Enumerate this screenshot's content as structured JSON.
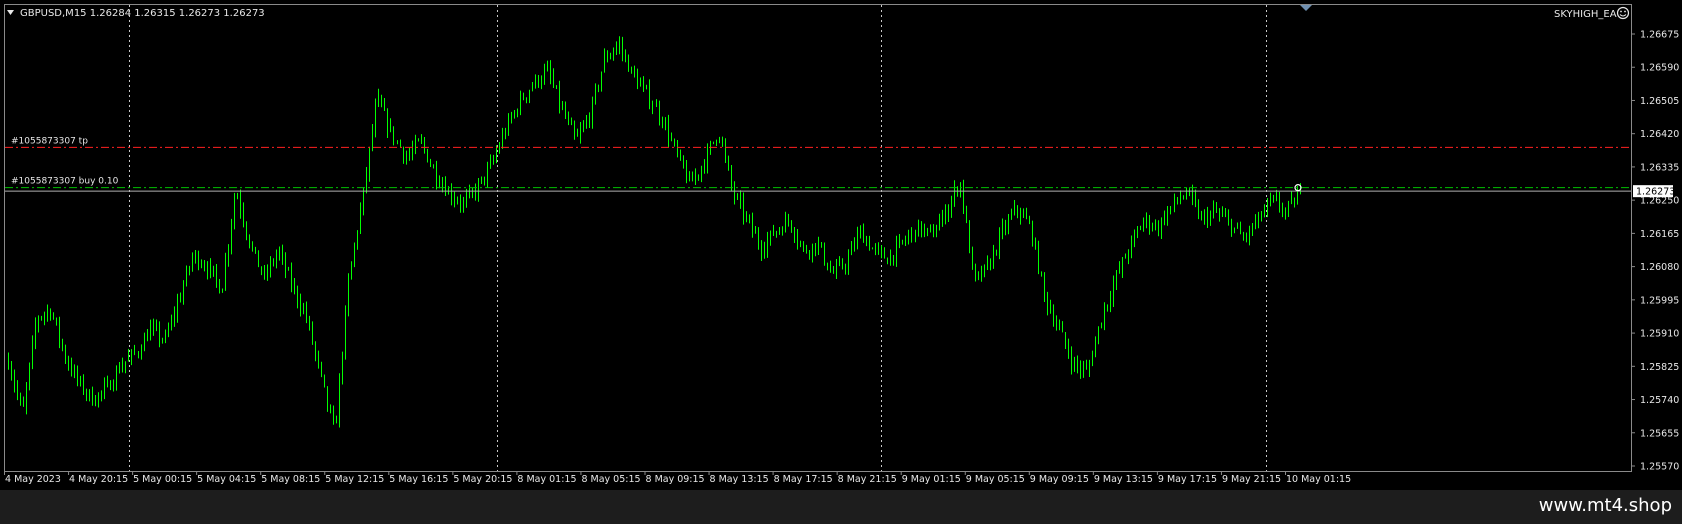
{
  "chart_header": {
    "symbol_line": "GBPUSD,M15  1.26284 1.26315 1.26273 1.26273",
    "ea_name": "SKYHIGH_EA",
    "ea_icon": "smiley-icon"
  },
  "colors": {
    "background": "#000000",
    "candles": "#00ff00",
    "grid": "#c8c8c8",
    "axis_text": "#e8e8e8",
    "tp_line": "#ff2020",
    "entry_line": "#00c000",
    "bid_line": "#b0b0b0",
    "price_label_bg": "#ffffff",
    "price_label_text": "#000000"
  },
  "trade_lines": {
    "tp_label": "#1055873307 tp",
    "tp_price": 1.26385,
    "entry_label": "#1055873307 buy 0.10",
    "entry_price": 1.26282
  },
  "current_price": "1.26273",
  "watermark": "www.mt4.shop",
  "chart_data": {
    "type": "candlestick",
    "title": "GBPUSD,M15",
    "timeframe": "M15",
    "ohlc_header": {
      "open": 1.26284,
      "high": 1.26315,
      "low": 1.26273,
      "close": 1.26273
    },
    "y_ticks": [
      "1.26675",
      "1.26590",
      "1.26505",
      "1.26420",
      "1.26335",
      "1.26250",
      "1.26165",
      "1.26080",
      "1.25995",
      "1.25910",
      "1.25825",
      "1.25740",
      "1.25655",
      "1.25570"
    ],
    "ylim": [
      1.2556,
      1.2671
    ],
    "x_ticks": [
      "4 May 2023",
      "4 May 20:15",
      "5 May 00:15",
      "5 May 04:15",
      "5 May 08:15",
      "5 May 12:15",
      "5 May 16:15",
      "5 May 20:15",
      "8 May 01:15",
      "8 May 05:15",
      "8 May 09:15",
      "8 May 13:15",
      "8 May 17:15",
      "8 May 21:15",
      "9 May 01:15",
      "9 May 05:15",
      "9 May 09:15",
      "9 May 13:15",
      "9 May 17:15",
      "9 May 21:15",
      "10 May 01:15"
    ],
    "grid": "vertical period separators",
    "close_path": [
      [
        0,
        1.2584
      ],
      [
        1,
        1.257
      ],
      [
        2,
        1.2595
      ],
      [
        3,
        1.2597
      ],
      [
        4,
        1.2585
      ],
      [
        5,
        1.2578
      ],
      [
        6,
        1.2574
      ],
      [
        7,
        1.2577
      ],
      [
        8,
        1.2583
      ],
      [
        9,
        1.2586
      ],
      [
        10,
        1.2592
      ],
      [
        11,
        1.2589
      ],
      [
        12,
        1.26
      ],
      [
        13,
        1.2611
      ],
      [
        14,
        1.2608
      ],
      [
        15,
        1.2602
      ],
      [
        16,
        1.2628
      ],
      [
        17,
        1.2614
      ],
      [
        18,
        1.2605
      ],
      [
        19,
        1.2612
      ],
      [
        20,
        1.2603
      ],
      [
        21,
        1.2595
      ],
      [
        22,
        1.258
      ],
      [
        23,
        1.2565
      ],
      [
        24,
        1.2605
      ],
      [
        25,
        1.2626
      ],
      [
        26,
        1.2651
      ],
      [
        27,
        1.2642
      ],
      [
        28,
        1.2636
      ],
      [
        29,
        1.264
      ],
      [
        30,
        1.2632
      ],
      [
        31,
        1.2627
      ],
      [
        32,
        1.2624
      ],
      [
        33,
        1.2628
      ],
      [
        34,
        1.2634
      ],
      [
        35,
        1.2643
      ],
      [
        36,
        1.265
      ],
      [
        37,
        1.2655
      ],
      [
        38,
        1.2658
      ],
      [
        39,
        1.2648
      ],
      [
        40,
        1.264
      ],
      [
        41,
        1.2647
      ],
      [
        42,
        1.2661
      ],
      [
        43,
        1.2665
      ],
      [
        44,
        1.2657
      ],
      [
        45,
        1.2652
      ],
      [
        46,
        1.2646
      ],
      [
        47,
        1.2637
      ],
      [
        48,
        1.2629
      ],
      [
        49,
        1.2635
      ],
      [
        50,
        1.2643
      ],
      [
        51,
        1.2627
      ],
      [
        52,
        1.262
      ],
      [
        53,
        1.2613
      ],
      [
        54,
        1.2617
      ],
      [
        55,
        1.262
      ],
      [
        56,
        1.2612
      ],
      [
        57,
        1.2614
      ],
      [
        58,
        1.2606
      ],
      [
        59,
        1.2609
      ],
      [
        60,
        1.2617
      ],
      [
        61,
        1.2612
      ],
      [
        62,
        1.261
      ],
      [
        63,
        1.2614
      ],
      [
        64,
        1.2618
      ],
      [
        65,
        1.2616
      ],
      [
        66,
        1.2622
      ],
      [
        67,
        1.263
      ],
      [
        68,
        1.2604
      ],
      [
        69,
        1.2608
      ],
      [
        70,
        1.2617
      ],
      [
        71,
        1.2623
      ],
      [
        72,
        1.2618
      ],
      [
        73,
        1.26
      ],
      [
        74,
        1.2592
      ],
      [
        75,
        1.2583
      ],
      [
        76,
        1.2581
      ],
      [
        77,
        1.2595
      ],
      [
        78,
        1.2605
      ],
      [
        79,
        1.2613
      ],
      [
        80,
        1.262
      ],
      [
        81,
        1.2618
      ],
      [
        82,
        1.2624
      ],
      [
        83,
        1.2627
      ],
      [
        84,
        1.262
      ],
      [
        85,
        1.2622
      ],
      [
        86,
        1.2619
      ],
      [
        87,
        1.2615
      ],
      [
        88,
        1.262
      ],
      [
        89,
        1.2625
      ],
      [
        90,
        1.2622
      ],
      [
        91,
        1.2627
      ]
    ]
  }
}
